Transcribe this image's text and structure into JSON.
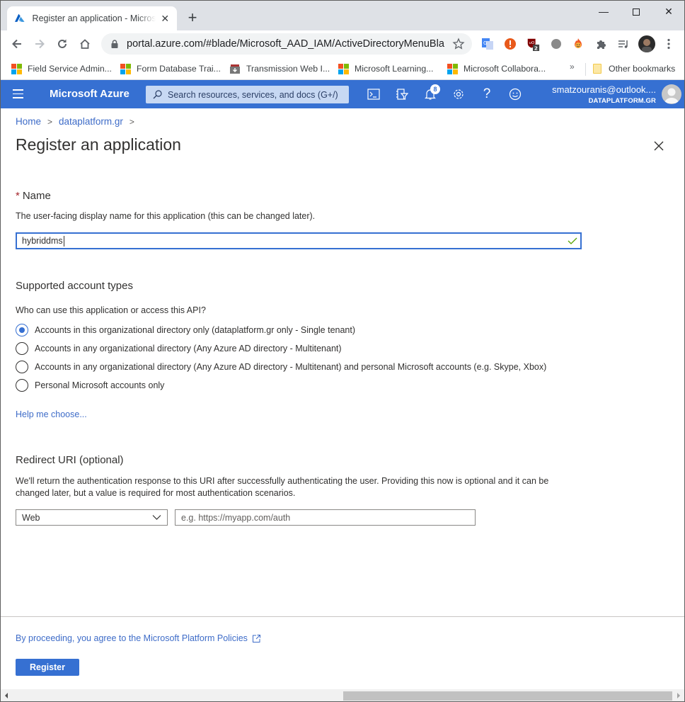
{
  "browser": {
    "tab": {
      "title": "Register an application - Microsoft Azure",
      "favicon": "azure-icon"
    },
    "new_tab": "+",
    "window_controls": {
      "minimize": "—",
      "close": "✕"
    },
    "url": "portal.azure.com/#blade/Microsoft_AAD_IAM/ActiveDirectoryMenuBla...",
    "extensions": [
      {
        "name": "google-translate-icon"
      },
      {
        "name": "alert-extension-icon"
      },
      {
        "name": "ublock-icon",
        "badge": "2"
      },
      {
        "name": "gray-circle-extension-icon"
      },
      {
        "name": "hola-icon"
      },
      {
        "name": "extensions-puzzle-icon"
      },
      {
        "name": "media-queue-icon"
      },
      {
        "name": "profile-avatar-icon"
      },
      {
        "name": "menu-kebab-icon"
      }
    ],
    "bookmarks": [
      {
        "label": "Field Service Admin...",
        "icon": "microsoft-icon"
      },
      {
        "label": "Form Database Trai...",
        "icon": "microsoft-icon"
      },
      {
        "label": "Transmission Web I...",
        "icon": "transmission-icon"
      },
      {
        "label": "Microsoft Learning...",
        "icon": "microsoft-icon"
      },
      {
        "label": "Microsoft Collabora...",
        "icon": "microsoft-icon"
      }
    ],
    "bookmarks_overflow": "»",
    "other_bookmarks": "Other bookmarks"
  },
  "azure_header": {
    "brand": "Microsoft Azure",
    "search_placeholder": "Search resources, services, and docs (G+/)",
    "notifications_count": "8",
    "account_email": "smatzouranis@outlook....",
    "account_tenant": "DATAPLATFORM.GR",
    "accent_color": "#3670d2"
  },
  "breadcrumb": [
    {
      "label": "Home"
    },
    {
      "label": "dataplatform.gr"
    }
  ],
  "breadcrumb_sep": ">",
  "page": {
    "title": "Register an application",
    "name_section": {
      "required_marker": "*",
      "label": "Name",
      "description": "The user-facing display name for this application (this can be changed later).",
      "value": "hybriddms",
      "valid": true
    },
    "account_types": {
      "heading": "Supported account types",
      "question": "Who can use this application or access this API?",
      "options": [
        {
          "label": "Accounts in this organizational directory only (dataplatform.gr only - Single tenant)",
          "selected": true
        },
        {
          "label": "Accounts in any organizational directory (Any Azure AD directory - Multitenant)",
          "selected": false
        },
        {
          "label": "Accounts in any organizational directory (Any Azure AD directory - Multitenant) and personal Microsoft accounts (e.g. Skype, Xbox)",
          "selected": false
        },
        {
          "label": "Personal Microsoft accounts only",
          "selected": false
        }
      ],
      "help_link": "Help me choose..."
    },
    "redirect": {
      "heading": "Redirect URI (optional)",
      "description_line1": "We'll return the authentication response to this URI after successfully authenticating the user. Providing this now is optional and it can be",
      "description_line2": "changed later, but a value is required for most authentication scenarios.",
      "platform_selected": "Web",
      "uri_value": "",
      "uri_placeholder": "e.g. https://myapp.com/auth"
    },
    "footer": {
      "policy_text": "By proceeding, you agree to the Microsoft Platform Policies",
      "register_label": "Register"
    }
  }
}
